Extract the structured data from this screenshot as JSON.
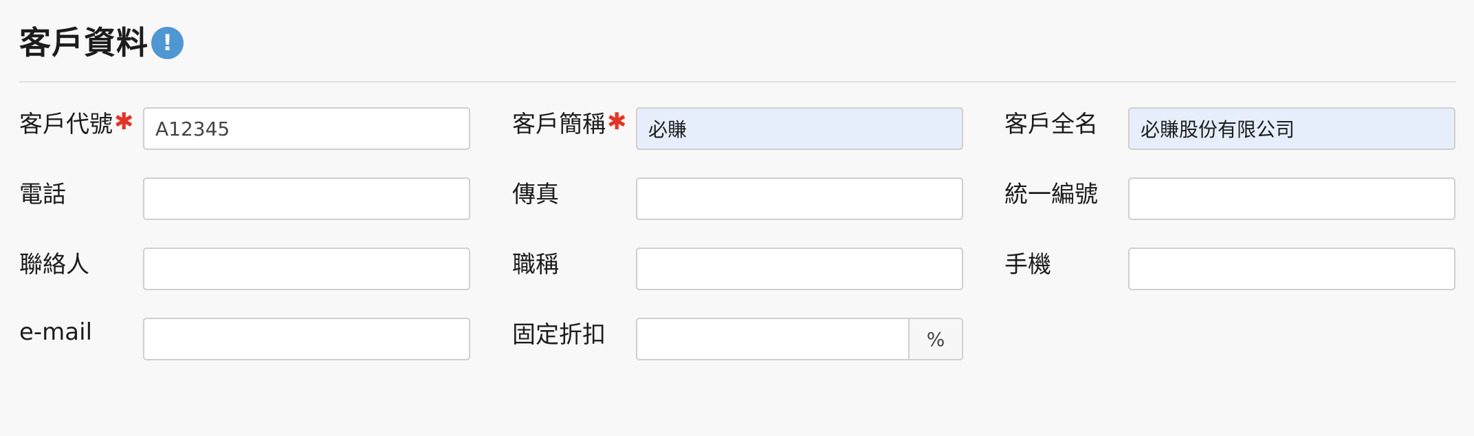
{
  "header": {
    "title": "客戶資料",
    "info_icon_glyph": "!",
    "info_icon": "info-exclamation-icon",
    "accent_color": "#4f97d2"
  },
  "required_marker": "✱",
  "required_color": "#e2352a",
  "fields": {
    "customer_code": {
      "label": "客戶代號",
      "value": "A12345"
    },
    "customer_short_name": {
      "label": "客戶簡稱",
      "value": "必賺"
    },
    "customer_full_name": {
      "label": "客戶全名",
      "value": "必賺股份有限公司"
    },
    "phone": {
      "label": "電話",
      "value": ""
    },
    "fax": {
      "label": "傳真",
      "value": ""
    },
    "tax_id": {
      "label": "統一編號",
      "value": ""
    },
    "contact": {
      "label": "聯絡人",
      "value": ""
    },
    "job_title": {
      "label": "職稱",
      "value": ""
    },
    "mobile": {
      "label": "手機",
      "value": ""
    },
    "email": {
      "label": "e-mail",
      "value": ""
    },
    "fixed_discount": {
      "label": "固定折扣",
      "value": "",
      "unit": "%"
    }
  },
  "highlight_color": "#e6eefc"
}
